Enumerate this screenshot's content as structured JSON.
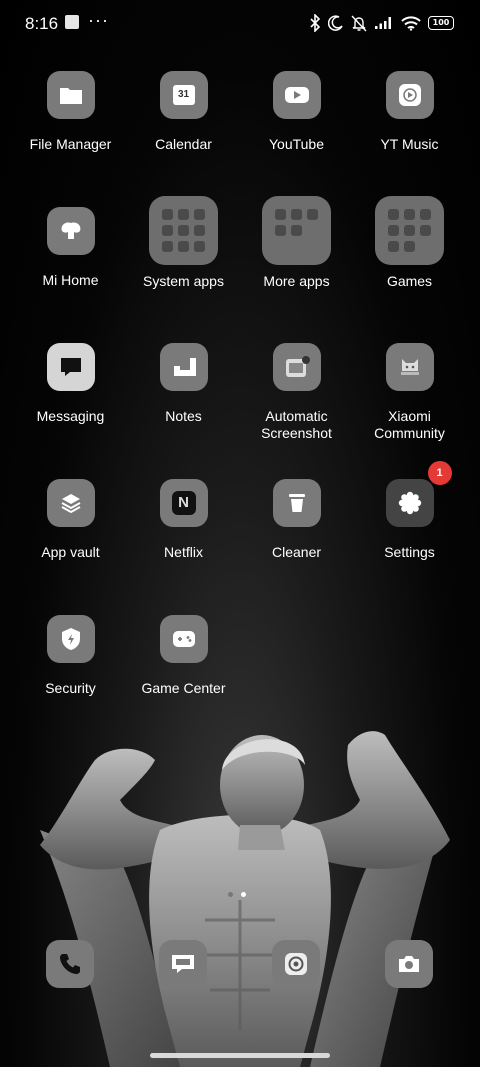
{
  "status_bar": {
    "time": "8:16",
    "more_indicator": "···",
    "battery": "100",
    "icons": [
      "bluetooth-icon",
      "moon-icon",
      "bell-muted-icon",
      "signal-icon",
      "wifi-icon",
      "battery-icon"
    ]
  },
  "apps": [
    {
      "label": "File Manager",
      "icon": "folder-icon"
    },
    {
      "label": "Calendar",
      "icon": "calendar-icon",
      "icon_text": "31"
    },
    {
      "label": "YouTube",
      "icon": "play-icon"
    },
    {
      "label": "YT Music",
      "icon": "music-play-icon"
    },
    {
      "label": "Mi Home",
      "icon": "mi-home-icon"
    },
    {
      "label": "System apps",
      "icon": "folder-grid-icon"
    },
    {
      "label": "More apps",
      "icon": "folder-grid-icon"
    },
    {
      "label": "Games",
      "icon": "folder-grid-icon"
    },
    {
      "label": "Messaging",
      "icon": "message-bubble-icon"
    },
    {
      "label": "Notes",
      "icon": "notes-icon"
    },
    {
      "label": "Automatic Screenshot",
      "icon": "screenshot-icon"
    },
    {
      "label": "Xiaomi Community",
      "icon": "community-icon"
    },
    {
      "label": "App vault",
      "icon": "layers-icon"
    },
    {
      "label": "Netflix",
      "icon": "netflix-icon",
      "icon_text": "N"
    },
    {
      "label": "Cleaner",
      "icon": "trash-icon"
    },
    {
      "label": "Settings",
      "icon": "gear-icon",
      "badge": "1"
    },
    {
      "label": "Security",
      "icon": "shield-icon"
    },
    {
      "label": "Game Center",
      "icon": "gamepad-icon"
    }
  ],
  "dock": [
    "phone-icon",
    "chat-icon",
    "browser-icon",
    "camera-icon"
  ],
  "colors": {
    "background": "#000000",
    "icon_tile": "#7a7a7a",
    "badge": "#e53935"
  }
}
